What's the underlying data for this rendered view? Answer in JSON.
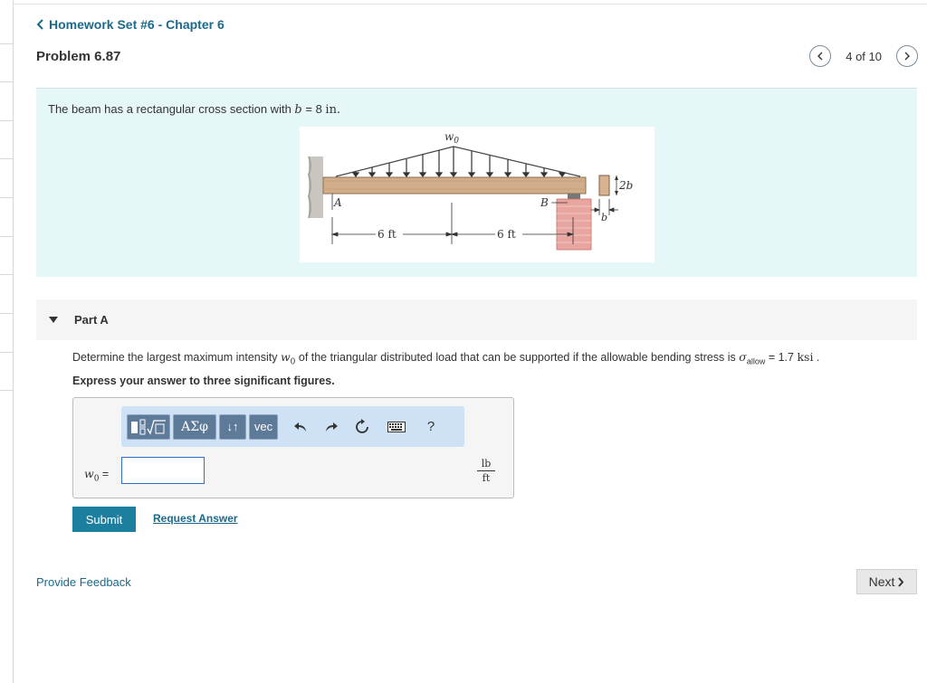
{
  "nav": {
    "back_label": "Homework Set #6 - Chapter 6",
    "problem_title": "Problem 6.87",
    "pager_text": "4 of 10",
    "next_label": "Next"
  },
  "statement": {
    "text_before": "The beam has a rectangular cross section with ",
    "var": "b",
    "text_after": " = 8 ",
    "unit": "in."
  },
  "figure": {
    "load_label": "w0",
    "support_a": "A",
    "support_b": "B",
    "dim_left": "6 ft",
    "dim_right": "6 ft",
    "section_height": "2b",
    "section_width": "b"
  },
  "part": {
    "label": "Part A",
    "question_before": "Determine the largest maximum intensity ",
    "question_var": "w",
    "question_sub": "0",
    "question_middle": " of the triangular distributed load that can be supported if the allowable bending stress is ",
    "sigma": "σ",
    "sigma_sub": "allow",
    "question_value": " = 1.7 ",
    "question_unit": "ksi",
    "question_end": " .",
    "instruction": "Express your answer to three significant figures."
  },
  "answer": {
    "label_var": "w",
    "label_sub": "0",
    "label_eq": " =",
    "input_value": "",
    "unit_top": "lb",
    "unit_bottom": "ft"
  },
  "toolbar": {
    "greek_label": "ΑΣφ",
    "sort_label": "↓↑",
    "vec_label": "vec",
    "help_label": "?"
  },
  "actions": {
    "submit_label": "Submit",
    "request_label": "Request Answer",
    "feedback_label": "Provide Feedback"
  }
}
